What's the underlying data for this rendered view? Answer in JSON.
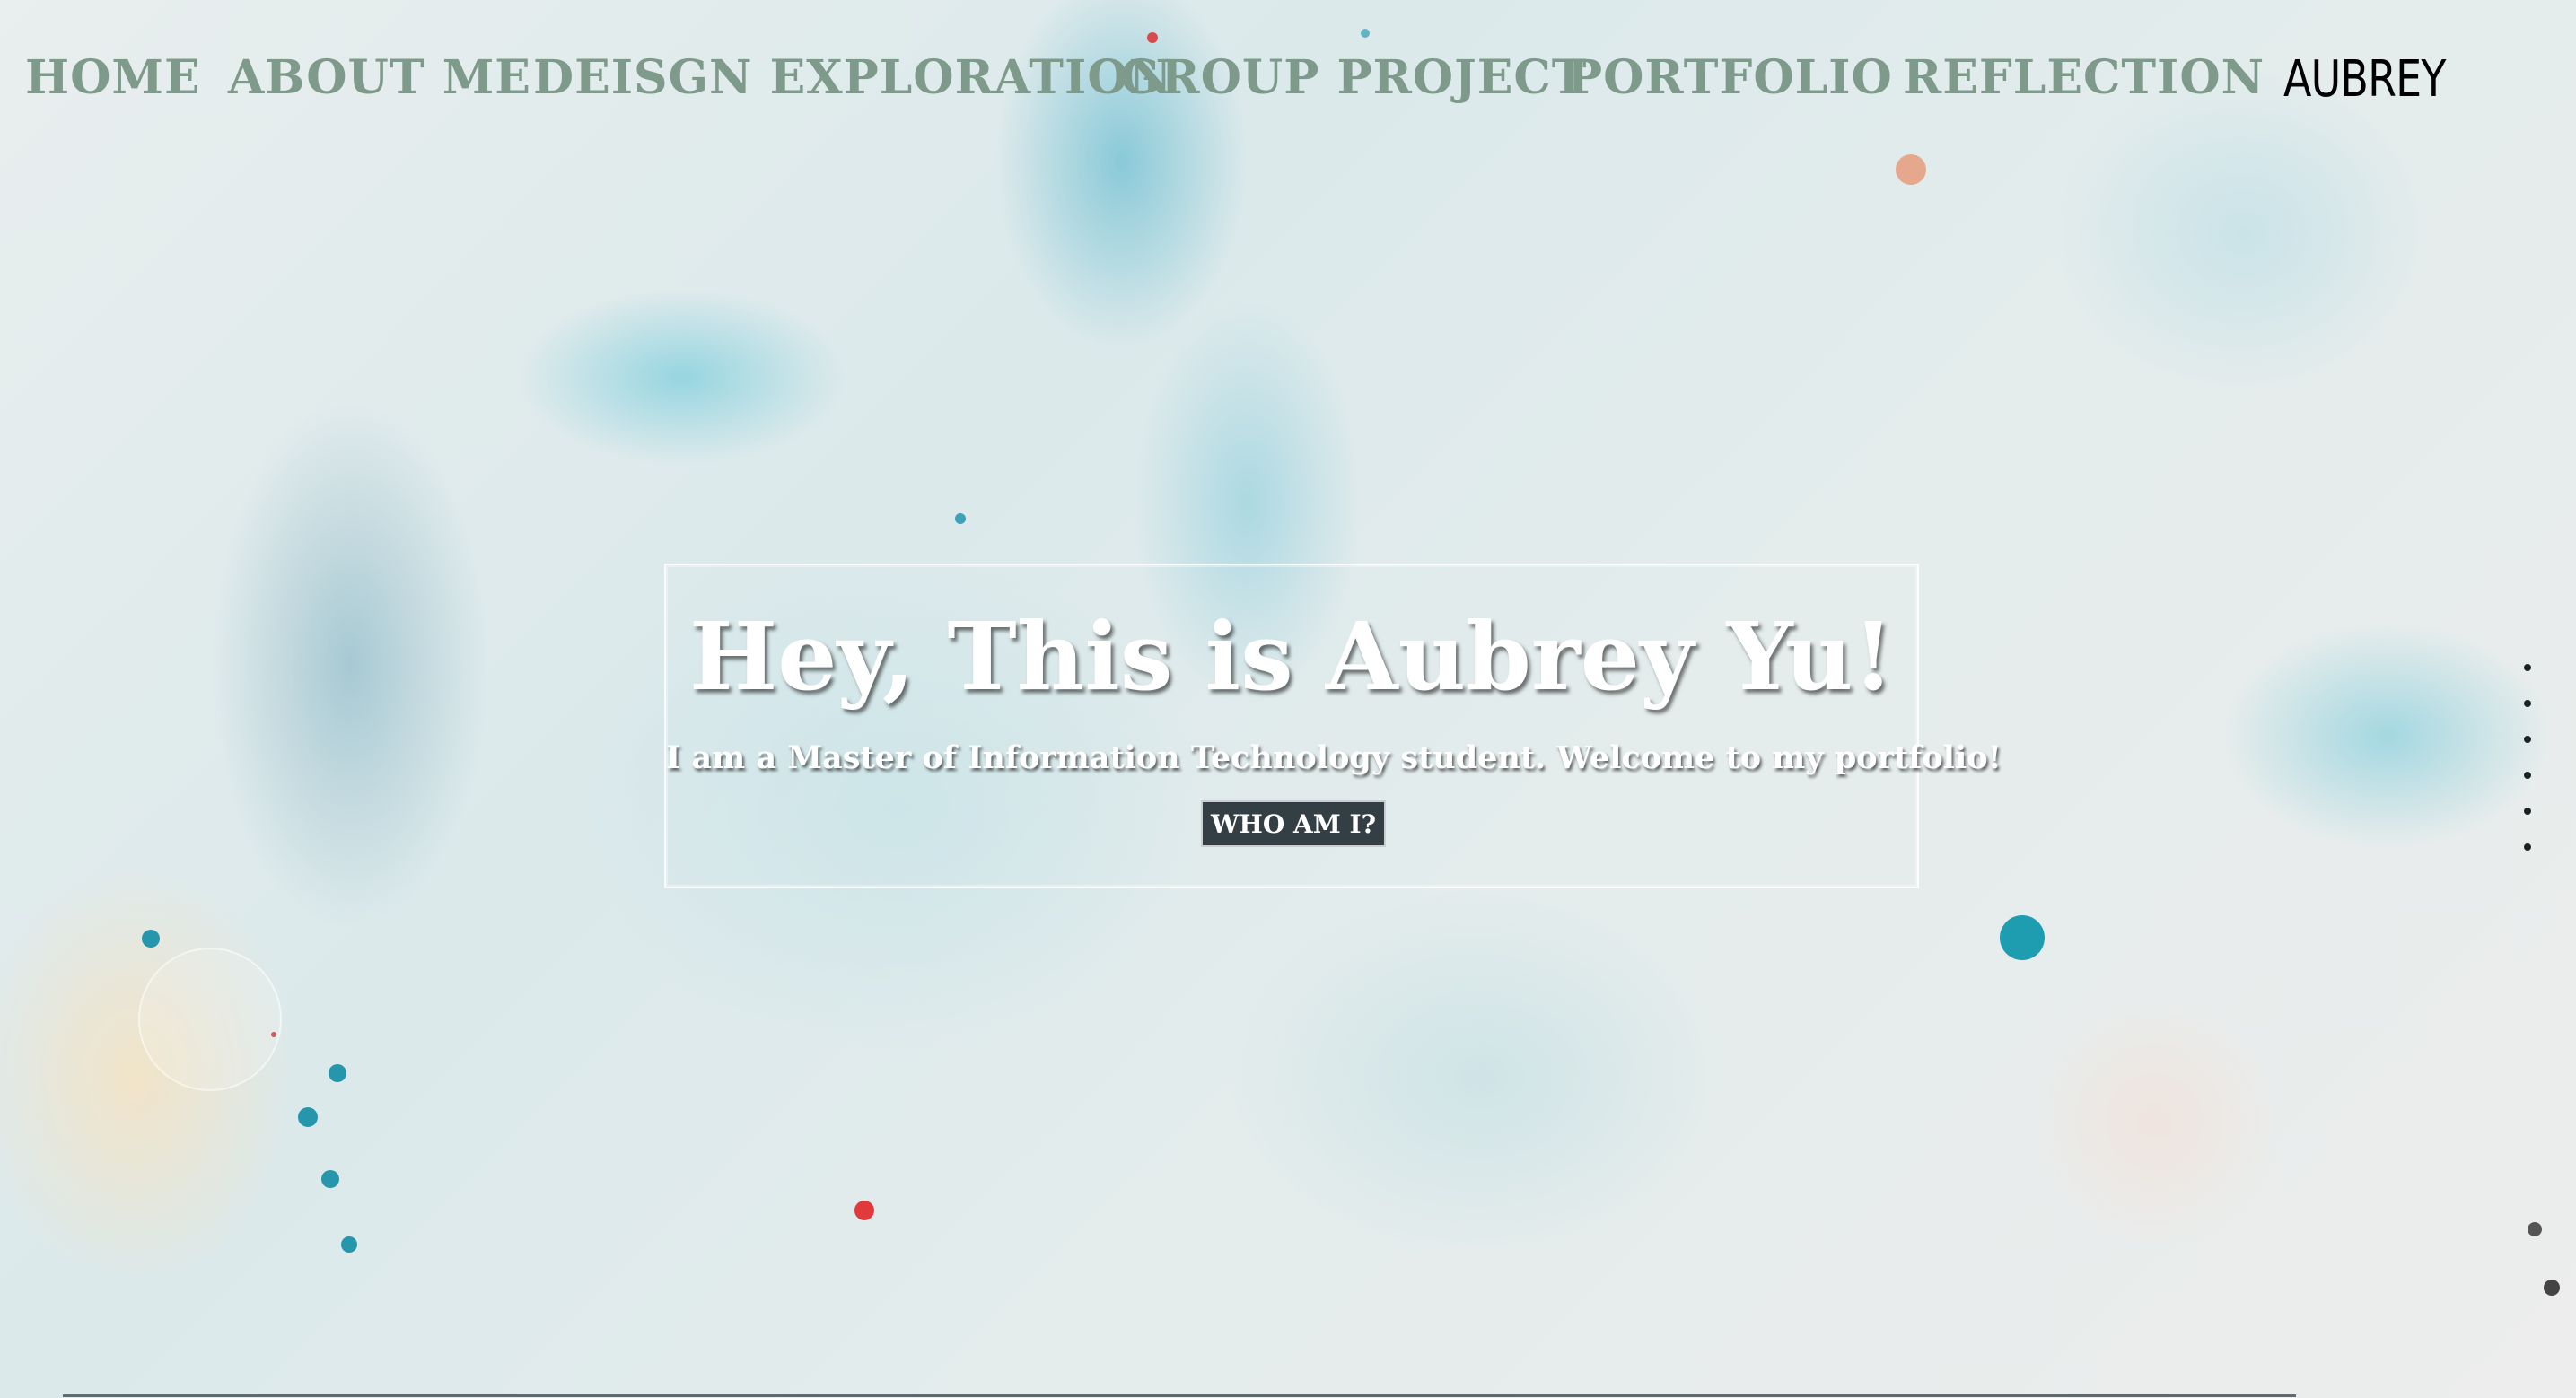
{
  "nav": {
    "items": [
      {
        "label": "HOME"
      },
      {
        "label": "ABOUT ME"
      },
      {
        "label": "DEISGN EXPLORATION"
      },
      {
        "label": "GROUP PROJECT"
      },
      {
        "label": "PORTFOLIO"
      },
      {
        "label": "REFLECTION"
      }
    ],
    "brand": "AUBREY",
    "color": "#7e9a8a"
  },
  "hero": {
    "title": "Hey, This is Aubrey Yu!",
    "subtitle": "I am a Master of Information Technology student. Welcome to my portfolio!",
    "button_label": "WHO AM I?",
    "button_color": "#333f44"
  },
  "section_dots": {
    "count": 6,
    "icon": "dot-icon"
  }
}
